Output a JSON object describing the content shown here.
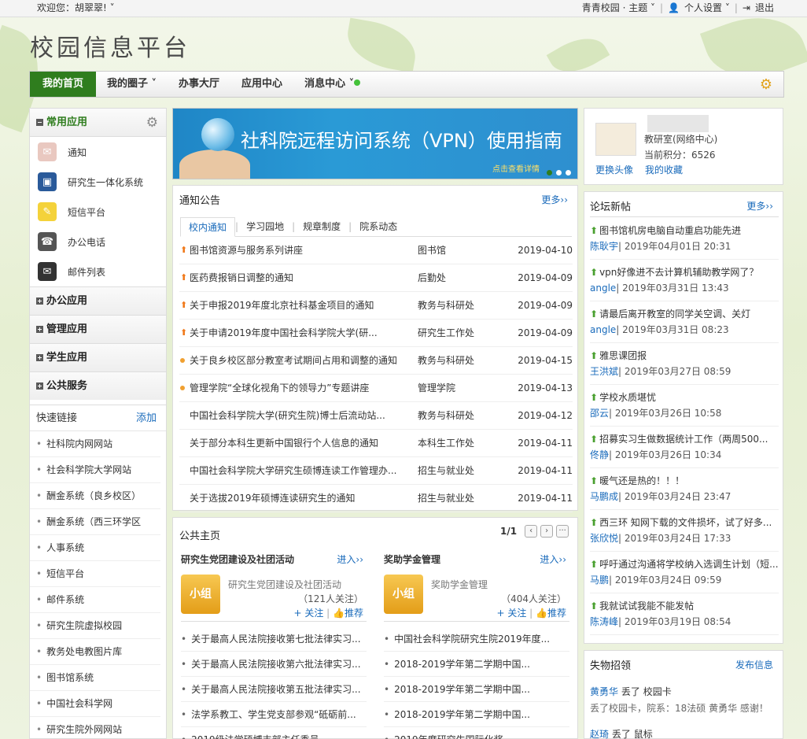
{
  "topbar": {
    "welcome": "欢迎您：胡翠翠! ˅",
    "theme": "青青校园 · 主题",
    "theme_caret": "˅",
    "settings": "个人设置",
    "settings_caret": "˅",
    "logout": "退出"
  },
  "logo": "校园信息平台",
  "nav": {
    "items": [
      {
        "label": "我的首页"
      },
      {
        "label": "我的圈子 ˅"
      },
      {
        "label": "办事大厅"
      },
      {
        "label": "应用中心"
      },
      {
        "label": "消息中心 ˅"
      }
    ]
  },
  "common": {
    "title": "常用应用",
    "apps": [
      {
        "label": "通知",
        "icon": "notice-icon",
        "color": "#e9c8c0"
      },
      {
        "label": "研究生一体化系统",
        "icon": "graduate-system-icon",
        "color": "#2a5a9a"
      },
      {
        "label": "短信平台",
        "icon": "sms-icon",
        "color": "#f4d23a"
      },
      {
        "label": "办公电话",
        "icon": "phone-icon",
        "color": "#555555"
      },
      {
        "label": "邮件列表",
        "icon": "mail-icon",
        "color": "#333333"
      }
    ]
  },
  "groups": [
    {
      "label": "办公应用"
    },
    {
      "label": "管理应用"
    },
    {
      "label": "学生应用"
    },
    {
      "label": "公共服务"
    }
  ],
  "quicklinks": {
    "title": "快速链接",
    "add": "添加",
    "items": [
      "社科院内网网站",
      "社会科学院大学网站",
      "酬金系统（良乡校区）",
      "酬金系统（西三环学区",
      "人事系统",
      "短信平台",
      "邮件系统",
      "研究生院虚拟校园",
      "教务处电教图片库",
      "图书馆系统",
      "中国社会科学网",
      "研究生院外网网站"
    ]
  },
  "banner": {
    "title": "社科院远程访问系统（VPN）使用指南",
    "sub": "点击查看详情"
  },
  "notices": {
    "title": "通知公告",
    "more": "更多››",
    "tabs": [
      "校内通知",
      "学习园地",
      "规章制度",
      "院系动态"
    ],
    "rows": [
      {
        "mark": "arrow",
        "title": "图书馆资源与服务系列讲座",
        "dept": "图书馆",
        "date": "2019-04-10"
      },
      {
        "mark": "arrow",
        "title": "医药费报销日调整的通知",
        "dept": "后勤处",
        "date": "2019-04-09"
      },
      {
        "mark": "arrow",
        "title": "关于申报2019年度北京社科基金项目的通知",
        "dept": "教务与科研处",
        "date": "2019-04-09"
      },
      {
        "mark": "arrow",
        "title": "关于申请2019年度中国社会科学院大学(研...",
        "dept": "研究生工作处",
        "date": "2019-04-09"
      },
      {
        "mark": "dot",
        "title": "关于良乡校区部分教室考试期间占用和调整的通知",
        "dept": "教务与科研处",
        "date": "2019-04-15"
      },
      {
        "mark": "dot",
        "title": "管理学院“全球化视角下的领导力”专题讲座",
        "dept": "管理学院",
        "date": "2019-04-13"
      },
      {
        "mark": "none",
        "title": "中国社会科学院大学(研究生院)博士后流动站...",
        "dept": "教务与科研处",
        "date": "2019-04-12"
      },
      {
        "mark": "none",
        "title": "关于部分本科生更新中国银行个人信息的通知",
        "dept": "本科生工作处",
        "date": "2019-04-11"
      },
      {
        "mark": "none",
        "title": "中国社会科学院大学研究生硕博连读工作管理办...",
        "dept": "招生与就业处",
        "date": "2019-04-11"
      },
      {
        "mark": "none",
        "title": "关于选拔2019年硕博连读研究生的通知",
        "dept": "招生与就业处",
        "date": "2019-04-11"
      }
    ]
  },
  "public": {
    "title": "公共主页",
    "page": "1/1",
    "clubs": [
      {
        "name": "研究生党团建设及社团活动",
        "enter": "进入››",
        "badge": "小组",
        "desc": "研究生党团建设及社团活动",
        "count": "（121人关注）",
        "follow": "+ 关注",
        "recommend": "推荐",
        "items": [
          "关于最高人民法院接收第七批法律实习...",
          "关于最高人民法院接收第六批法律实习...",
          "关于最高人民法院接收第五批法律实习...",
          "法学系教工、学生党支部参观“砥砺前...",
          "2019级法学硕博支部主任委员..."
        ]
      },
      {
        "name": "奖助学金管理",
        "enter": "进入››",
        "badge": "小组",
        "desc": "奖助学金管理",
        "count": "（404人关注）",
        "follow": "+ 关注",
        "recommend": "推荐",
        "items": [
          "中国社会科学院研究生院2019年度...",
          "2018-2019学年第二学期中国...",
          "2018-2019学年第二学期中国...",
          "2018-2019学年第二学期中国...",
          "2019年度研究生国际化奖..."
        ]
      }
    ]
  },
  "profile": {
    "org": "教研室(网络中心)",
    "points": "当前积分：6526",
    "change_avatar": "更换头像",
    "favorites": "我的收藏"
  },
  "forum": {
    "title": "论坛新帖",
    "more": "更多››",
    "posts": [
      {
        "title": "图书馆机房电脑自动重启功能先进",
        "author": "陈耿宇",
        "time": "| 2019年04月01日 20:31"
      },
      {
        "title": "vpn好像进不去计算机辅助教学网了？",
        "author": "angle",
        "time": "| 2019年03月31日 13:43"
      },
      {
        "title": "请最后离开教室的同学关空调、关灯",
        "author": "angle",
        "time": "| 2019年03月31日 08:23"
      },
      {
        "title": "雅思课团报",
        "author": "王洪斌",
        "time": "| 2019年03月27日 08:59"
      },
      {
        "title": "学校水质堪忧",
        "author": "邵云",
        "time": "| 2019年03月26日 10:58"
      },
      {
        "title": "招募实习生做数据统计工作（两周500...",
        "author": "佟静",
        "time": "| 2019年03月26日 10:34"
      },
      {
        "title": "暖气还是热的！！！",
        "author": "马鹏成",
        "time": "| 2019年03月24日 23:47"
      },
      {
        "title": "西三环 知网下载的文件损坏，试了好多...",
        "author": "张欣悦",
        "time": "| 2019年03月24日 17:33"
      },
      {
        "title": "呼吁通过沟通将学校纳入选调生计划（短...",
        "author": "马鹏",
        "time": "| 2019年03月24日 09:59"
      },
      {
        "title": "我就试试我能不能发帖",
        "author": "陈涛峰",
        "time": "| 2019年03月19日 08:54"
      }
    ]
  },
  "lost": {
    "title": "失物招领",
    "publish": "发布信息",
    "entries": [
      {
        "name": "黄勇华",
        "action": "丢了",
        "item": "校园卡",
        "sub": "丢了校园卡，院系：18法硕 黄勇华 感谢！"
      },
      {
        "name": "赵琦",
        "action": "丢了",
        "item": "鼠标",
        "sub": ""
      }
    ]
  }
}
